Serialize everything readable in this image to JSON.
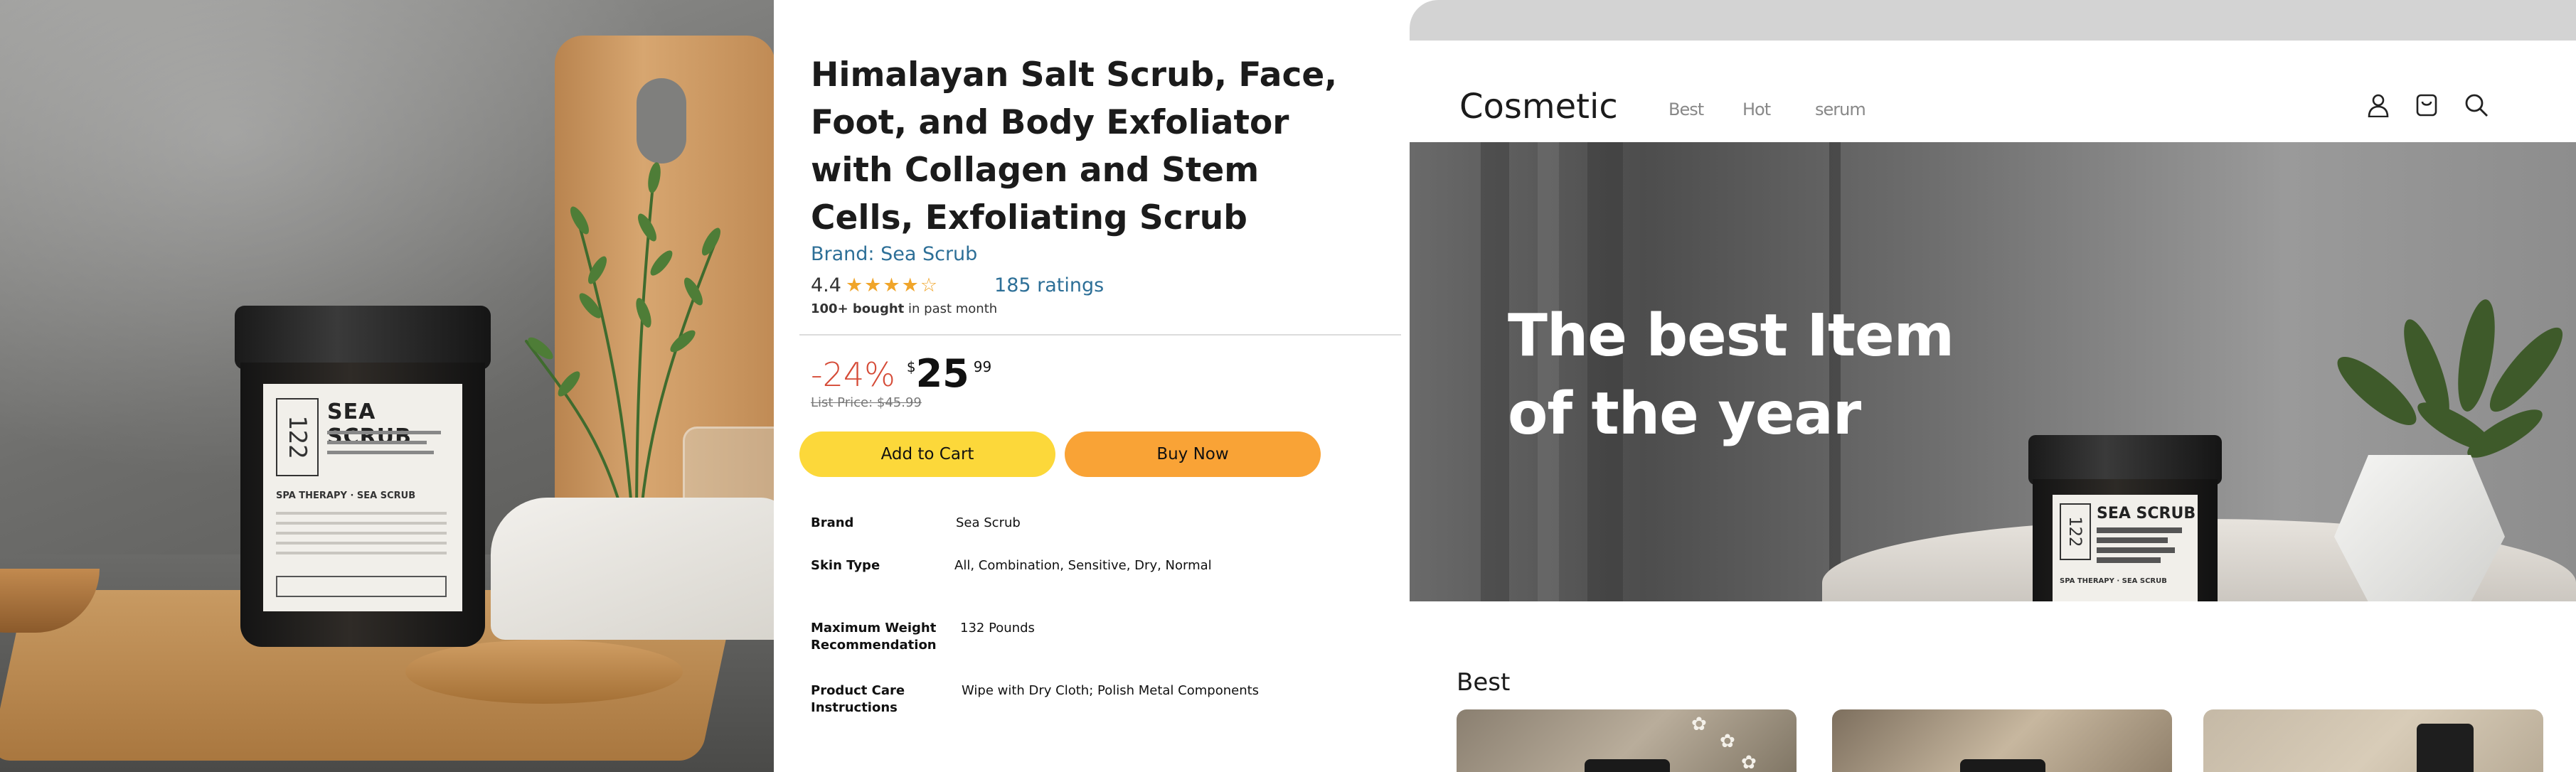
{
  "product": {
    "title": "Himalayan Salt Scrub, Face, Foot, and Body Exfoliator with Collagen and Stem Cells, Exfoliating Scrub",
    "brand_link": "Brand: Sea Scrub",
    "rating_value": "4.4",
    "rating_stars": 4.4,
    "ratings_count": "185 ratings",
    "bought_bold": "100+ bought",
    "bought_rest": " in past month",
    "discount": "-24%",
    "currency": "$",
    "price_whole": "25",
    "price_fraction": "99",
    "list_price": "List Price: $45.99",
    "add_to_cart": "Add to Cart",
    "buy_now": "Buy Now",
    "specs": [
      {
        "key": "Brand",
        "value": "Sea Scrub"
      },
      {
        "key": "Skin Type",
        "value": "All, Combination, Sensitive, Dry, Normal"
      },
      {
        "key": "Maximum Weight Recommendation",
        "value": "132 Pounds"
      },
      {
        "key": "Product Care Instructions",
        "value": "Wipe with Dry Cloth; Polish Metal Components"
      }
    ]
  },
  "jar_label": {
    "number": "122",
    "title": "SEA SCRUB",
    "subtitle": "SPA THERAPY · SEA SCRUB"
  },
  "site": {
    "logo": "Cosmetic",
    "nav": [
      "Best",
      "Hot",
      "serum"
    ],
    "icons": [
      "user-icon",
      "bag-icon",
      "search-icon"
    ],
    "hero_headline": "The best Item of the year",
    "section_title": "Best"
  },
  "colors": {
    "link": "#2d6f97",
    "star": "#f0a52a",
    "discount": "#d54a36",
    "add_to_cart": "#fcd83a",
    "buy_now": "#f9a336"
  }
}
